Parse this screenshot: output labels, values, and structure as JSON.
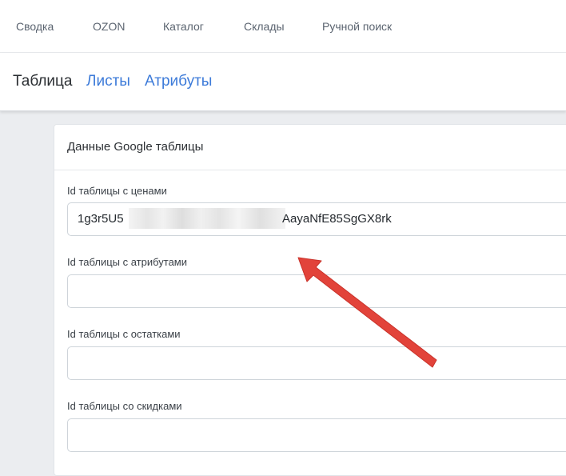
{
  "topnav": {
    "items": [
      "Сводка",
      "OZON",
      "Каталог",
      "Склады",
      "Ручной поиск"
    ]
  },
  "subnav": {
    "tabs": [
      {
        "label": "Таблица",
        "active": true
      },
      {
        "label": "Листы",
        "active": false
      },
      {
        "label": "Атрибуты",
        "active": false
      }
    ]
  },
  "card": {
    "title": "Данные Google таблицы",
    "fields": [
      {
        "label": "Id таблицы с ценами",
        "value_start": "1g3r5U5",
        "value_end": "AayaNfE85SgGX8rk"
      },
      {
        "label": "Id таблицы с атрибутами",
        "value": ""
      },
      {
        "label": "Id таблицы с остатками",
        "value": ""
      },
      {
        "label": "Id таблицы со скидками",
        "value": ""
      }
    ]
  },
  "colors": {
    "link": "#3d7bd9",
    "arrow": "#e2433a",
    "background": "#ebedf0"
  }
}
